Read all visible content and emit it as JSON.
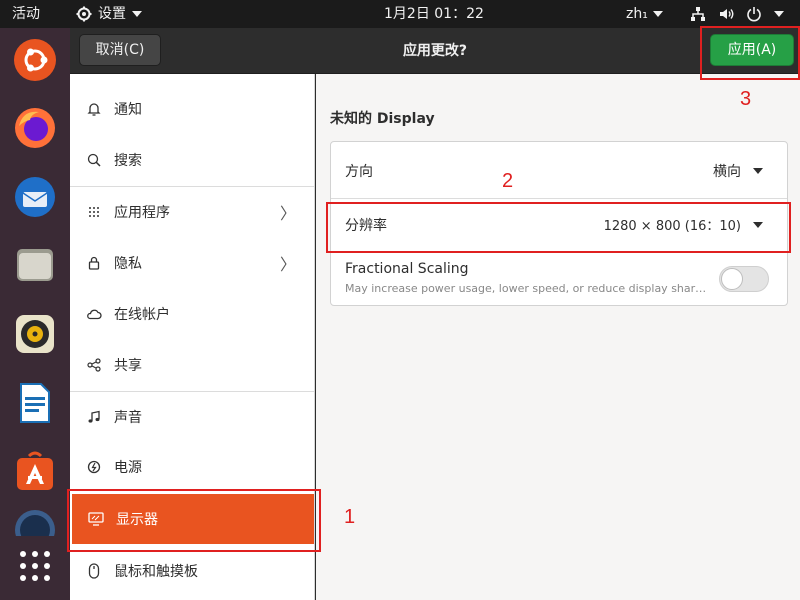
{
  "topbar": {
    "activities": "活动",
    "app_menu": "设置",
    "clock": "1月2日  01：22",
    "input_method": "zh₁"
  },
  "header": {
    "cancel_label": "取消(C)",
    "title": "应用更改?",
    "apply_label": "应用(A)"
  },
  "sidebar": {
    "items": [
      {
        "label": "通知",
        "icon": "bell-icon"
      },
      {
        "label": "搜索",
        "icon": "search-icon"
      },
      {
        "label": "应用程序",
        "icon": "apps-grid-icon",
        "has_arrow": true
      },
      {
        "label": "隐私",
        "icon": "lock-icon",
        "has_arrow": true
      },
      {
        "label": "在线帐户",
        "icon": "cloud-icon"
      },
      {
        "label": "共享",
        "icon": "share-icon"
      },
      {
        "label": "声音",
        "icon": "music-note-icon"
      },
      {
        "label": "电源",
        "icon": "power-icon"
      },
      {
        "label": "显示器",
        "icon": "display-icon",
        "active": true
      },
      {
        "label": "鼠标和触摸板",
        "icon": "mouse-icon"
      }
    ],
    "arrow": "〉"
  },
  "display": {
    "section_title": "未知的 Display",
    "orientation_label": "方向",
    "orientation_value": "横向",
    "resolution_label": "分辨率",
    "resolution_value": "1280 × 800 (16：10)",
    "scaling_label": "Fractional Scaling",
    "scaling_desc": "May increase power usage, lower speed, or reduce display sharpness.",
    "scaling_enabled": false
  },
  "annotations": [
    "1",
    "2",
    "3"
  ],
  "colors": {
    "accent": "#e95420",
    "apply": "#26a046",
    "annotation": "#e02020"
  }
}
